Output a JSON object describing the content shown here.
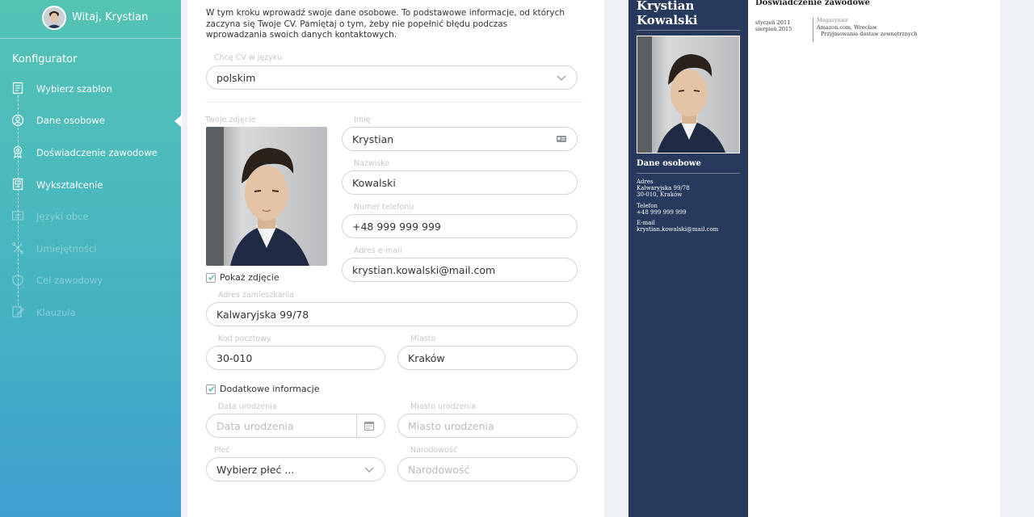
{
  "sidebar": {
    "greeting": "Witaj, Krystian",
    "configurator_title": "Konfigurator",
    "steps": [
      {
        "label": "Wybierz szablon",
        "icon": "template-icon",
        "state": "done"
      },
      {
        "label": "Dane osobowe",
        "icon": "user-icon",
        "state": "active"
      },
      {
        "label": "Doświadczenie zawodowe",
        "icon": "experience-icon",
        "state": "done"
      },
      {
        "label": "Wykształcenie",
        "icon": "education-icon",
        "state": "done"
      },
      {
        "label": "Języki obce",
        "icon": "languages-icon",
        "state": "disabled"
      },
      {
        "label": "Umiejętności",
        "icon": "skills-icon",
        "state": "disabled"
      },
      {
        "label": "Cel zawodowy",
        "icon": "goal-icon",
        "state": "disabled"
      },
      {
        "label": "Klauzula",
        "icon": "clause-icon",
        "state": "disabled"
      }
    ]
  },
  "form": {
    "intro": "W tym kroku wprowadź swoje dane osobowe. To podstawowe informacje, od których zaczyna się Twoje CV. Pamiętaj o tym, żeby nie popełnić błędu podczas wprowadzania swoich danych kontaktowych.",
    "language": {
      "label": "Chcę CV w języku",
      "value": "polskim"
    },
    "photo_label": "Twoje zdjęcie",
    "show_photo": {
      "label": "Pokaż zdjęcie",
      "checked": true
    },
    "first_name": {
      "label": "Imię",
      "value": "Krystian"
    },
    "last_name": {
      "label": "Nazwisko",
      "value": "Kowalski"
    },
    "phone": {
      "label": "Numer telefonu",
      "value": "+48 999 999 999"
    },
    "email": {
      "label": "Adres e-mail",
      "value": "krystian.kowalski@mail.com"
    },
    "address": {
      "label": "Adres zamieszkania",
      "value": "Kalwaryjska 99/78"
    },
    "postal_code": {
      "label": "Kod pocztowy",
      "value": "30-010"
    },
    "city": {
      "label": "Miasto",
      "value": "Kraków"
    },
    "extra_info": {
      "label": "Dodatkowe informacje",
      "checked": true
    },
    "birth_date": {
      "label": "Data urodzenia",
      "placeholder": "Data urodzenia"
    },
    "birth_place": {
      "label": "Miasto urodzenia",
      "placeholder": "Miasto urodzenia"
    },
    "gender": {
      "label": "Płeć",
      "value": "Wybierz płeć ..."
    },
    "nationality": {
      "label": "Narodowość",
      "placeholder": "Narodowość"
    }
  },
  "cv_preview": {
    "name": "Krystian Kowalski",
    "section_personal": "Dane osobowe",
    "address_label": "Adres",
    "address_line1": "Kalwaryjska 99/78",
    "address_line2": "30-010, Kraków",
    "phone_label": "Telefon",
    "phone": "+48 999 999 999",
    "email_label": "E-mail",
    "email": "krystian.kowalski@mail.com",
    "section_experience": "Doświadczenie zawodowe",
    "job": {
      "date_from": "styczeń 2011",
      "date_to": "sierpień 2015",
      "title": "Magazynier",
      "company": "Amazon.com, Wrocław",
      "duty": "Przyjmowanie dostaw zewnętrznych"
    }
  },
  "colors": {
    "sidebar_top": "#54c3b4",
    "sidebar_bottom": "#3f9fcf",
    "cv_navy": "#273a5d"
  }
}
